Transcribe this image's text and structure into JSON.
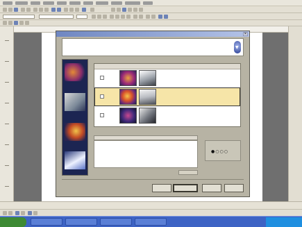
{
  "app": {
    "menu_items": [
      "",
      "",
      "",
      "",
      "",
      "",
      "",
      "",
      "",
      "",
      ""
    ],
    "font_name": "",
    "font_size": "",
    "status_text": ""
  },
  "dialog": {
    "title": "",
    "header_title": "",
    "header_subtitle": "",
    "grid_label": "",
    "grid_columns": [
      "",
      "",
      ""
    ],
    "pane_label": "",
    "pane_header": "",
    "pane_text": "",
    "preview_label": "",
    "small_button": "",
    "buttons": {
      "back": "",
      "next": "",
      "finish": "",
      "cancel": ""
    }
  },
  "taskbar": {
    "start_label": "",
    "tasks": [
      "",
      "",
      "",
      ""
    ]
  },
  "icons": [
    "close-icon",
    "wizard-icon",
    "checkbox-icon",
    "thumbnail-icon"
  ],
  "colors": {
    "selection_row": "#f6e5a8",
    "dialog_face": "#b7b3a4",
    "taskbar": "#3d63c4",
    "side_panel": "#1c2552"
  }
}
